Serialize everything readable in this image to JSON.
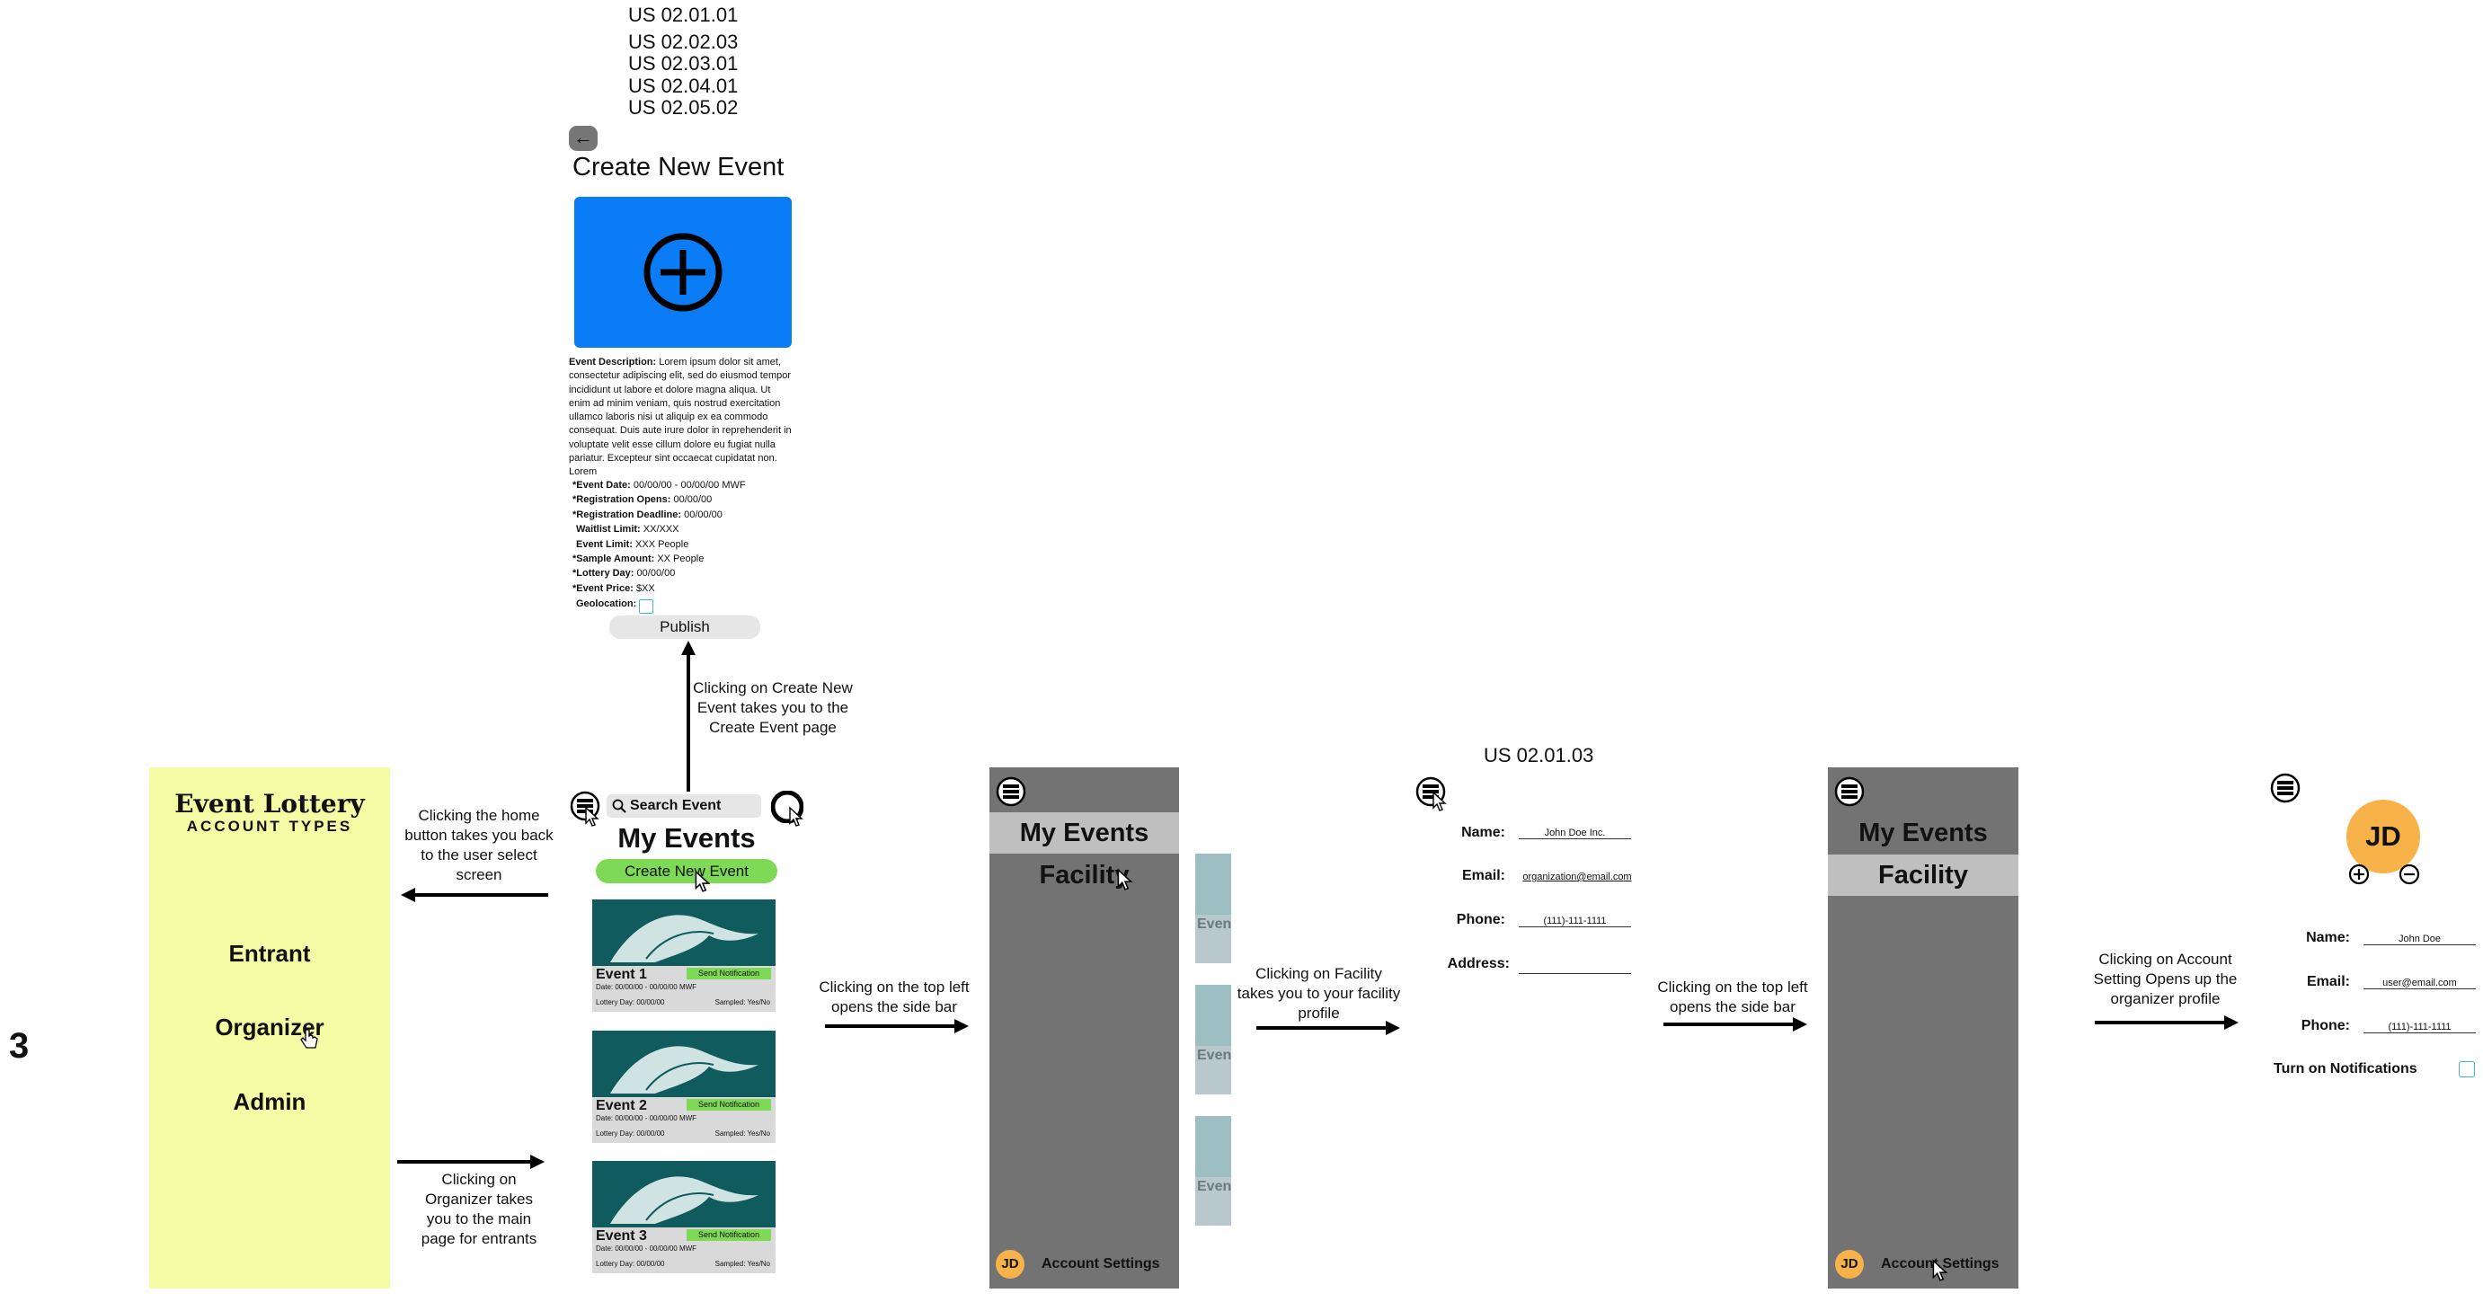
{
  "section_number": "3",
  "user_stories_top": [
    "US 02.01.01",
    "US 02.02.03",
    "US 02.03.01",
    "US 02.04.01",
    "US 02.05.02"
  ],
  "user_story_facility": "US 02.01.03",
  "account_types": {
    "title": "Event Lottery",
    "subtitle": "ACCOUNT TYPES",
    "options": [
      "Entrant",
      "Organizer",
      "Admin"
    ],
    "bg_color": "#f4fca5"
  },
  "annotations": {
    "home_back": "Clicking the home button takes you back to the user select screen",
    "organizer_click": "Clicking on Organizer takes you to the main page for entrants",
    "create_event_click": "Clicking on Create New Event takes you to the Create Event page",
    "side_bar_1": "Clicking on the top left opens the side bar",
    "facility_click": "Clicking on Facility takes you to your facility profile",
    "side_bar_2": "Clicking on the top left opens the side bar",
    "account_setting_click": "Clicking on Account Setting Opens up the organizer profile"
  },
  "my_events_screen": {
    "search_placeholder": "Search Event",
    "title": "My Events",
    "create_button": "Create New Event",
    "events": [
      {
        "name": "Event 1",
        "notify": "Send Notification",
        "date": "Date: 00/00/00 - 00/00/00 MWF",
        "lottery": "Lottery Day: 00/00/00",
        "sampled": "Sampled: Yes/No"
      },
      {
        "name": "Event 2",
        "notify": "Send Notification",
        "date": "Date: 00/00/00 - 00/00/00 MWF",
        "lottery": "Lottery Day: 00/00/00",
        "sampled": "Sampled: Yes/No"
      },
      {
        "name": "Event 3",
        "notify": "Send Notification",
        "date": "Date: 00/00/00 - 00/00/00 MWF",
        "lottery": "Lottery Day: 00/00/00",
        "sampled": "Sampled: Yes/No"
      }
    ],
    "accent_green": "#7ed957"
  },
  "create_event": {
    "title": "Create New Event",
    "image_color": "#0a7cf6",
    "description_label": "Event Description:",
    "description_text": "Lorem ipsum dolor sit amet, consectetur adipiscing elit, sed do eiusmod tempor incididunt ut labore et dolore magna aliqua. Ut enim ad minim veniam, quis nostrud exercitation ullamco laboris nisi ut aliquip ex ea commodo consequat. Duis aute irure dolor in reprehenderit in voluptate velit esse cillum dolore eu fugiat nulla pariatur. Excepteur sint occaecat cupidatat non. Lorem",
    "fields": [
      {
        "label": "*Event Date:",
        "value": "00/00/00 - 00/00/00 MWF"
      },
      {
        "label": "*Registration Opens:",
        "value": "00/00/00"
      },
      {
        "label": "*Registration Deadline:",
        "value": "00/00/00"
      },
      {
        "label": "Waitlist Limit:",
        "value": "XX/XXX"
      },
      {
        "label": "Event Limit:",
        "value": "XXX People"
      },
      {
        "label": "*Sample Amount:",
        "value": "XX People"
      },
      {
        "label": "*Lottery  Day:",
        "value": "00/00/00"
      },
      {
        "label": "*Event Price:",
        "value": "$XX"
      },
      {
        "label": "Geolocation:",
        "value": ""
      }
    ],
    "publish": "Publish"
  },
  "sidebar_1": {
    "items": [
      "My Events",
      "Facility"
    ],
    "avatar": "JD",
    "account": "Account Settings"
  },
  "partial_events": [
    "Even",
    "Even",
    "Even"
  ],
  "facility_profile": {
    "fields": [
      {
        "label": "Name:",
        "value": "John Doe Inc."
      },
      {
        "label": "Email:",
        "value": "organization@email.com"
      },
      {
        "label": "Phone:",
        "value": "(111)-111-1111"
      },
      {
        "label": "Address:",
        "value": ""
      }
    ]
  },
  "sidebar_2": {
    "items": [
      "My Events",
      "Facility"
    ],
    "avatar": "JD",
    "account": "Account Settings"
  },
  "organizer_profile": {
    "avatar": "JD",
    "avatar_color": "#f7b24a",
    "fields": [
      {
        "label": "Name:",
        "value": "John Doe"
      },
      {
        "label": "Email:",
        "value": "user@email.com"
      },
      {
        "label": "Phone:",
        "value": "(111)-111-1111"
      }
    ],
    "notifications": "Turn on Notifications"
  }
}
